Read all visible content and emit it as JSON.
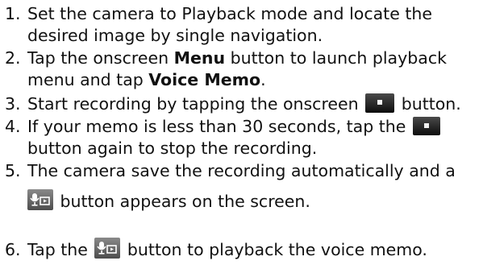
{
  "steps": [
    {
      "number": "1.",
      "line1": "Set the camera to Playback mode and locate the",
      "line2": "desired image by single navigation."
    },
    {
      "number": "2.",
      "line1_a": "Tap the onscreen ",
      "line1_bold": "Menu",
      "line1_b": " button to launch playback",
      "line2_a": "menu and tap ",
      "line2_bold": "Voice Memo",
      "line2_b": "."
    },
    {
      "number": "3.",
      "text_a": "Start recording by tapping the onscreen ",
      "icon": "record-button-icon",
      "text_b": " button."
    },
    {
      "number": "4.",
      "line1_a": "If your memo is less than 30 seconds, tap the ",
      "icon": "record-button-icon",
      "line2": "button again to stop the recording."
    },
    {
      "number": "5.",
      "line1": "The camera save the recording automatically and a",
      "icon": "voice-memo-playback-icon",
      "line2_b": " button appears on the screen."
    },
    {
      "number": "6.",
      "text_a": "Tap the ",
      "icon": "voice-memo-playback-icon",
      "text_b": " button to playback the voice memo."
    }
  ],
  "colors": {
    "text": "#111111",
    "icon_dark": "#1b1b1b",
    "icon_light": "#f2f2f2",
    "memo_icon_bg": "#6f6f6f"
  }
}
